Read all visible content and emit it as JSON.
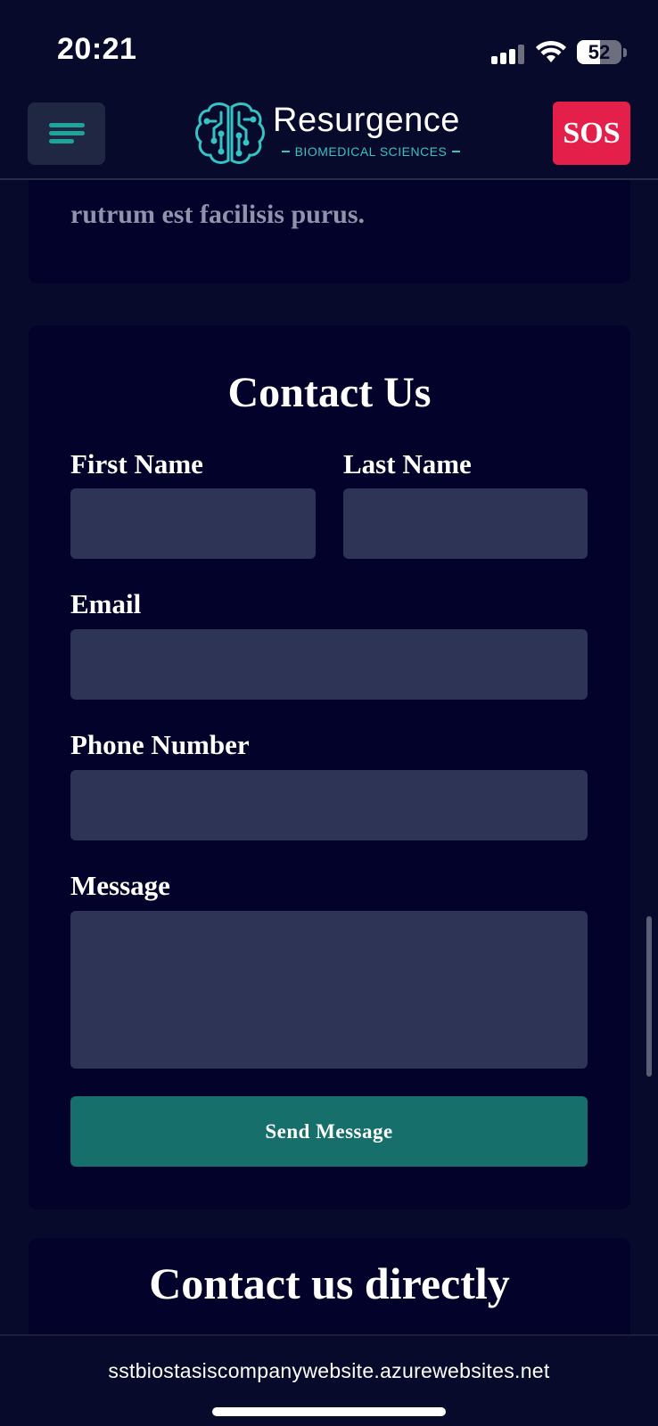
{
  "status_bar": {
    "time": "20:21",
    "battery_level": "52",
    "battery_fraction": 0.52,
    "icons": [
      "signal-icon",
      "wifi-icon",
      "battery-icon"
    ]
  },
  "header": {
    "menu_icon": "hamburger-menu-icon",
    "logo_icon": "brain-circuit-icon",
    "logo_title": "Resurgence",
    "logo_subtitle": "BIOMEDICAL SCIENCES",
    "sos_label": "SOS"
  },
  "previous_section": {
    "text": "rutrum est facilisis purus."
  },
  "contact_form": {
    "title": "Contact Us",
    "first_name_label": "First Name",
    "first_name_value": "",
    "last_name_label": "Last Name",
    "last_name_value": "",
    "email_label": "Email",
    "email_value": "",
    "phone_label": "Phone Number",
    "phone_value": "",
    "message_label": "Message",
    "message_value": "",
    "submit_label": "Send Message"
  },
  "direct_contact": {
    "title": "Contact us directly"
  },
  "browser": {
    "url": "sstbiostasiscompanywebsite.azurewebsites.net"
  },
  "colors": {
    "background": "#080a2c",
    "card": "#03022a",
    "input": "#2d3456",
    "accent_teal": "#176f6c",
    "logo_teal": "#35c3c4",
    "sos_red": "#e31f4a"
  }
}
